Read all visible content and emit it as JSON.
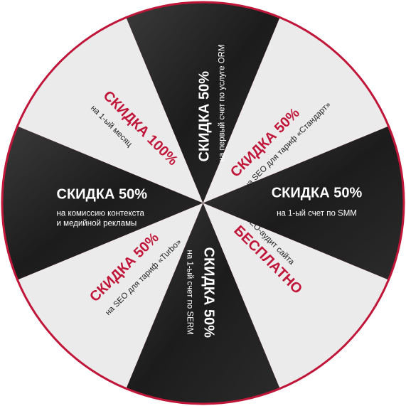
{
  "wheel": {
    "rim_color": "#c0163a",
    "light_color": "#ebebeb",
    "dark_color": "#222222",
    "accent_color": "#c0163a",
    "sectors": [
      {
        "title": "СКИДКА 50%",
        "sub": [
          "на 1-ый счет по SMM"
        ],
        "theme": "dark"
      },
      {
        "title": "БЕСПЛАТНО",
        "sub": [
          "SEO-аудит сайта"
        ],
        "theme": "light"
      },
      {
        "title": "СКИДКА 50%",
        "sub": [
          "на 1-ый счет по SERM"
        ],
        "theme": "dark"
      },
      {
        "title": "СКИДКА 50%",
        "sub": [
          "на SEO для тариф «Turbo»"
        ],
        "theme": "light"
      },
      {
        "title": "СКИДКА 50%",
        "sub": [
          "на комиссию контекста",
          "и медийной рекламы"
        ],
        "theme": "dark"
      },
      {
        "title": "СКИДКА 100%",
        "sub": [
          "на 1-ый месяц"
        ],
        "theme": "light"
      },
      {
        "title": "СКИДКА 50%",
        "sub": [
          "на первый счет по услуге ORM"
        ],
        "theme": "dark"
      },
      {
        "title": "СКИДКА 50%",
        "sub": [
          "на SEO для тариф «Стандарт»"
        ],
        "theme": "light"
      }
    ]
  }
}
